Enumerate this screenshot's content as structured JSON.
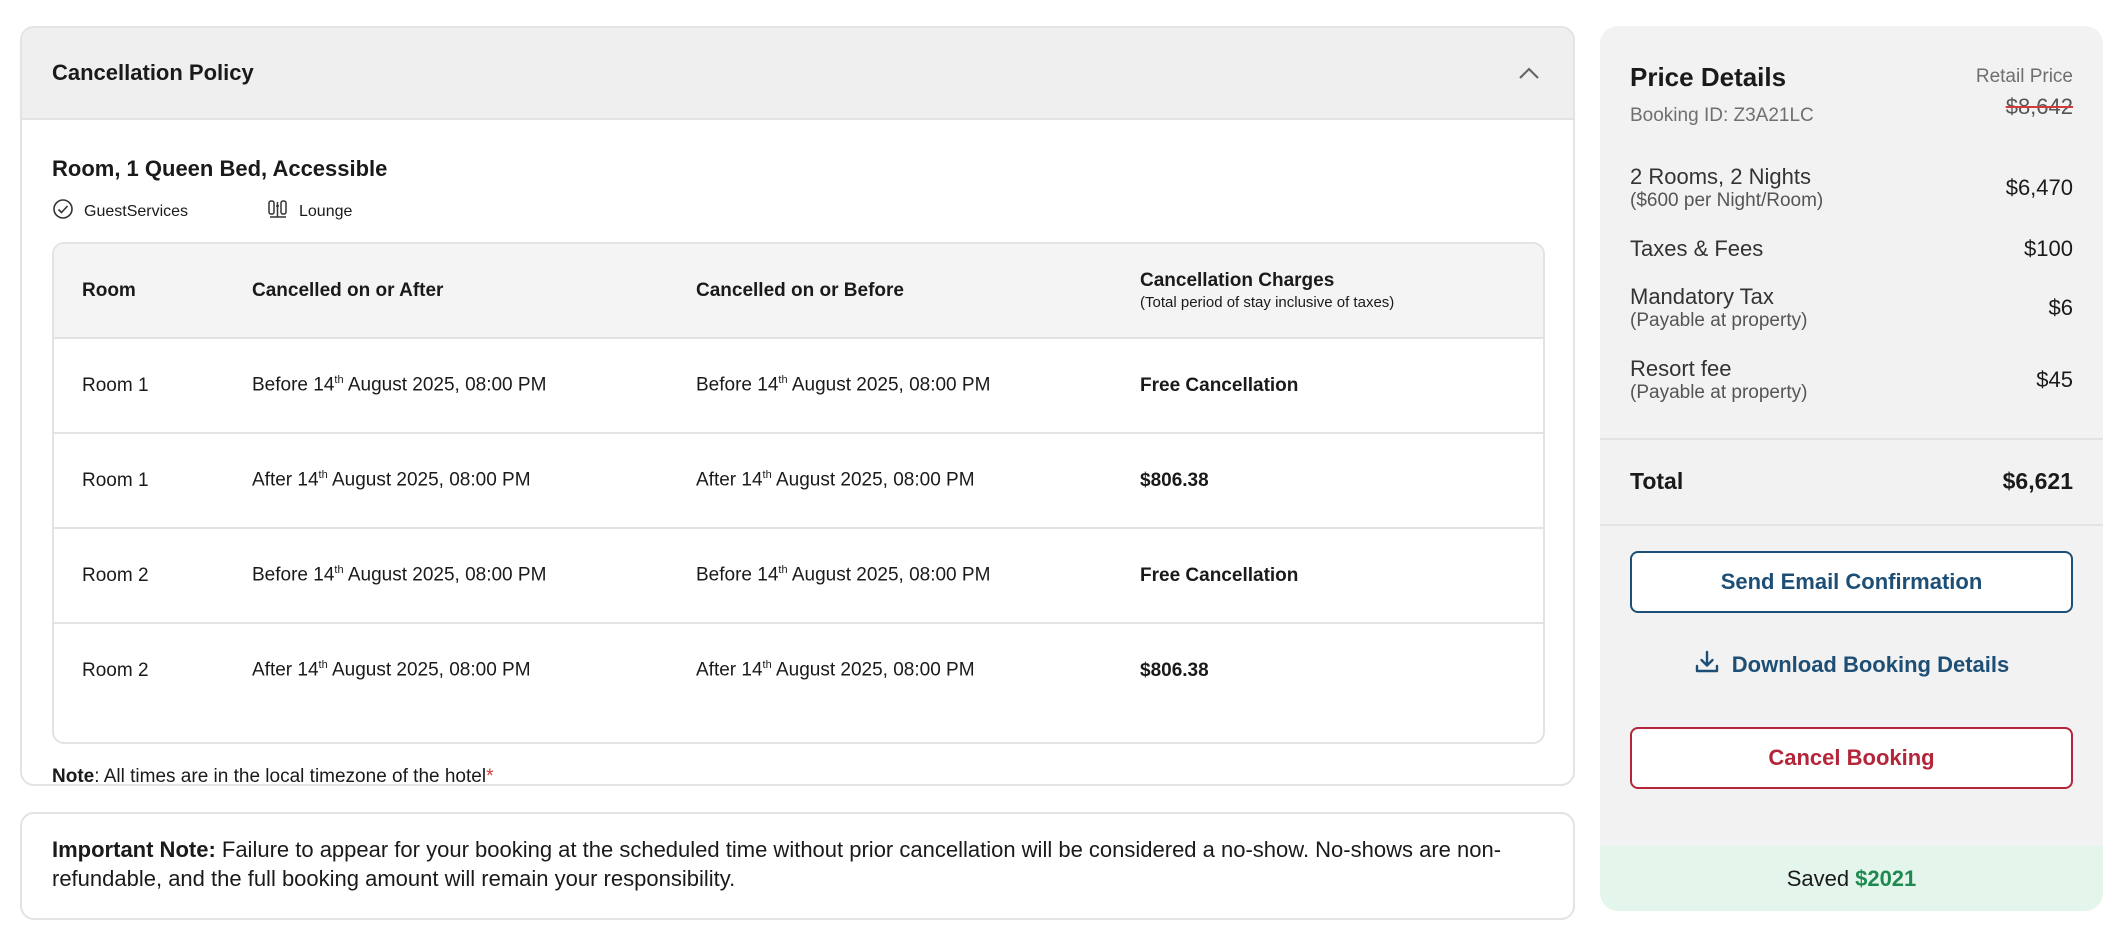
{
  "cancellation": {
    "title": "Cancellation Policy",
    "room_title": "Room, 1 Queen Bed, Accessible",
    "amenities": [
      {
        "label": "GuestServices",
        "icon": "check-circle-icon"
      },
      {
        "label": "Lounge",
        "icon": "lounge-icon"
      }
    ],
    "table": {
      "headers": {
        "room": "Room",
        "after": "Cancelled on or After",
        "before": "Cancelled on or Before",
        "charges": "Cancellation Charges",
        "charges_sub": "(Total period of stay inclusive of taxes)"
      },
      "rows": [
        {
          "room": "Room 1",
          "after_prefix": "Before 14",
          "after_suffix": " August 2025, 08:00 PM",
          "before_prefix": "Before 14",
          "before_suffix": " August 2025, 08:00 PM",
          "charge": "Free Cancellation"
        },
        {
          "room": "Room 1",
          "after_prefix": "After 14",
          "after_suffix": " August 2025, 08:00 PM",
          "before_prefix": "After 14",
          "before_suffix": " August 2025, 08:00 PM",
          "charge": "$806.38"
        },
        {
          "room": "Room 2",
          "after_prefix": "Before 14",
          "after_suffix": " August 2025, 08:00 PM",
          "before_prefix": "Before 14",
          "before_suffix": " August 2025, 08:00 PM",
          "charge": "Free Cancellation"
        },
        {
          "room": "Room 2",
          "after_prefix": "After 14",
          "after_suffix": " August 2025, 08:00 PM",
          "before_prefix": "After 14",
          "before_suffix": " August 2025, 08:00 PM",
          "charge": "$806.38"
        }
      ],
      "ordinal": "th"
    },
    "note_label": "Note",
    "note_text": ": All times are in the local timezone of the hotel",
    "note_asterisk": "*"
  },
  "important": {
    "label": "Important Note:",
    "text": " Failure to appear for your booking at the scheduled time without prior cancellation will be considered a no-show. No-shows are non-refundable, and the full booking amount will remain your responsibility."
  },
  "price": {
    "title": "Price Details",
    "booking_id": "Booking ID: Z3A21LC",
    "retail_label": "Retail Price",
    "retail_value": "$8,642",
    "items": {
      "rooms": {
        "label": "2 Rooms, 2 Nights",
        "sub": "($600 per Night/Room)",
        "value": "$6,470"
      },
      "taxes": {
        "label": "Taxes & Fees",
        "value": "$100"
      },
      "mandatory": {
        "label": "Mandatory Tax",
        "sub": "(Payable at property)",
        "value": "$6"
      },
      "resort": {
        "label": "Resort fee",
        "sub": "(Payable at property)",
        "value": "$45"
      }
    },
    "total_label": "Total",
    "total_value": "$6,621",
    "buttons": {
      "email": "Send Email Confirmation",
      "download": "Download Booking Details",
      "cancel": "Cancel Booking"
    },
    "saved_label": "Saved",
    "saved_value": "$2021"
  },
  "colors": {
    "accent_blue": "#1d4f76",
    "danger_red": "#b3263a",
    "saved_green": "#1e8a4f"
  }
}
